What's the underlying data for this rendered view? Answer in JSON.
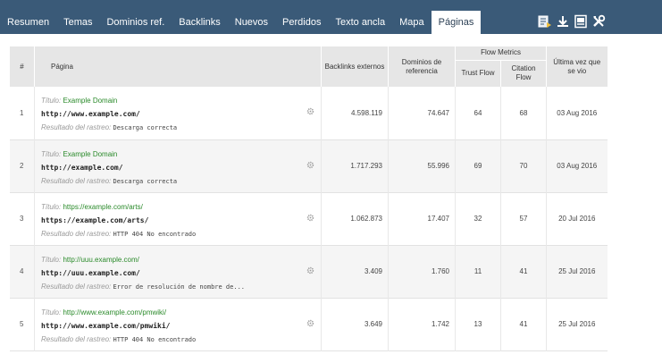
{
  "nav": {
    "tabs": [
      {
        "label": "Resumen",
        "active": false
      },
      {
        "label": "Temas",
        "active": false
      },
      {
        "label": "Dominios ref.",
        "active": false
      },
      {
        "label": "Backlinks",
        "active": false
      },
      {
        "label": "Nuevos",
        "active": false
      },
      {
        "label": "Perdidos",
        "active": false
      },
      {
        "label": "Texto ancla",
        "active": false
      },
      {
        "label": "Mapa",
        "active": false
      },
      {
        "label": "Páginas",
        "active": true
      }
    ],
    "tools": [
      "export-excel-icon",
      "download-icon",
      "report-icon",
      "tools-icon"
    ]
  },
  "table": {
    "headers": {
      "num": "#",
      "page": "Página",
      "backlinks": "Backlinks externos",
      "refdomains": "Dominios de referencia",
      "flow_metrics": "Flow Metrics",
      "trust_flow": "Trust Flow",
      "citation_flow": "Citation Flow",
      "last_seen": "Última vez que se vio"
    },
    "labels": {
      "title": "Título:",
      "crawl": "Resultado del rastreo:"
    },
    "rows": [
      {
        "num": "1",
        "title": "Example Domain",
        "url": "http://www.example.com/",
        "crawl": "Descarga correcta",
        "backlinks": "4.598.119",
        "refdomains": "74.647",
        "tf": "64",
        "cf": "68",
        "date": "03 Aug 2016"
      },
      {
        "num": "2",
        "title": "Example Domain",
        "url": "http://example.com/",
        "crawl": "Descarga correcta",
        "backlinks": "1.717.293",
        "refdomains": "55.996",
        "tf": "69",
        "cf": "70",
        "date": "03 Aug 2016"
      },
      {
        "num": "3",
        "title": "https://example.com/arts/",
        "url": "https://example.com/arts/",
        "crawl": "HTTP 404 No encontrado",
        "backlinks": "1.062.873",
        "refdomains": "17.407",
        "tf": "32",
        "cf": "57",
        "date": "20 Jul 2016"
      },
      {
        "num": "4",
        "title": "http://uuu.example.com/",
        "url": "http://uuu.example.com/",
        "crawl": "Error de resolución de nombre de...",
        "backlinks": "3.409",
        "refdomains": "1.760",
        "tf": "11",
        "cf": "41",
        "date": "25 Jul 2016"
      },
      {
        "num": "5",
        "title": "http://www.example.com/pmwiki/",
        "url": "http://www.example.com/pmwiki/",
        "crawl": "HTTP 404 No encontrado",
        "backlinks": "3.649",
        "refdomains": "1.742",
        "tf": "13",
        "cf": "41",
        "date": "25 Jul 2016"
      }
    ]
  }
}
